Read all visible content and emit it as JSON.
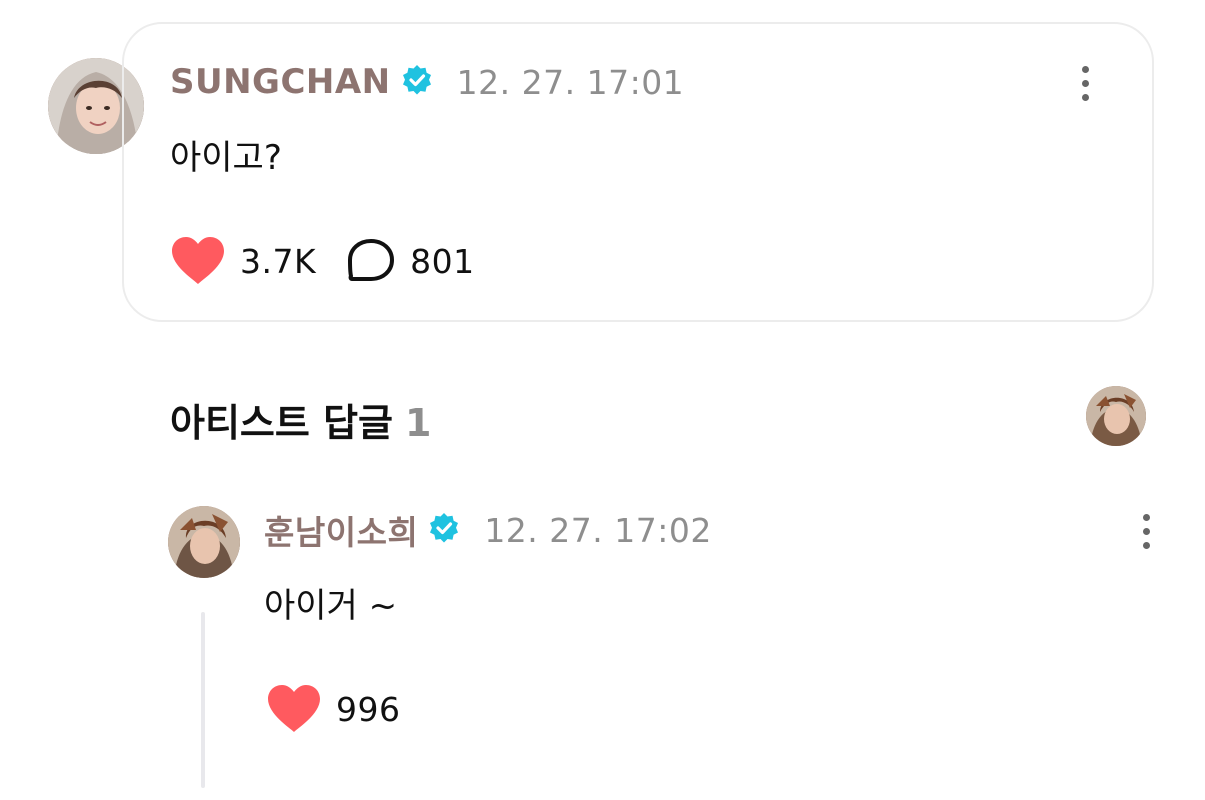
{
  "post": {
    "author": "SUNGCHAN",
    "verified_icon": "verified-badge-icon",
    "timestamp": "12. 27. 17:01",
    "text": "아이고?",
    "likes": "3.7K",
    "comments": "801",
    "more_icon": "more-vertical-icon"
  },
  "replies_section": {
    "title": "아티스트 답글",
    "count": "1"
  },
  "reply": {
    "author": "훈남이소희",
    "verified_icon": "verified-badge-icon",
    "timestamp": "12. 27. 17:02",
    "text": "아이거 ~",
    "likes": "996",
    "more_icon": "more-vertical-icon"
  },
  "colors": {
    "author": "#8d7470",
    "verified": "#1fc2e0",
    "heart": "#ff5a5f",
    "timestamp": "#8e8e8e"
  }
}
